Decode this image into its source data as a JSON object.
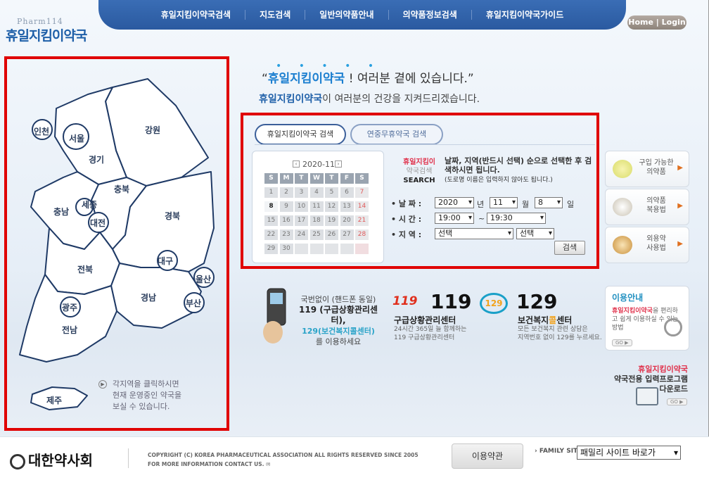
{
  "header": {
    "logo_sub": "Pharm114",
    "logo_main": "휴일지킴이약국",
    "nav": [
      "휴일지킴이약국검색",
      "지도검색",
      "일반의약품안내",
      "의약품정보검색",
      "휴일지킴이약국가이드"
    ],
    "home_login": "Home | Login"
  },
  "map": {
    "regions": [
      "인천",
      "서울",
      "경기",
      "강원",
      "충북",
      "충남",
      "세종",
      "대전",
      "경북",
      "대구",
      "전북",
      "울산",
      "경남",
      "광주",
      "부산",
      "전남",
      "제주"
    ],
    "note_lines": [
      "각지역을 클릭하시면",
      "현재 운영중인 약국을",
      "보실 수 있습니다."
    ]
  },
  "slogan": {
    "line1_brand": "휴일지킴이약국",
    "line1_rest": " ! 여러분 곁에 있습니다.",
    "line1_open": "“",
    "line1_close": "”",
    "line2_brand": "휴일지킴이약국",
    "line2_rest": "이 여러분의 건강을 지켜드리겠습니다."
  },
  "search": {
    "tab_active": "휴일지킴이약국 검색",
    "tab_inactive": "연중무휴약국 검색",
    "calendar": {
      "title": "2020-11",
      "prev": "‹",
      "next": "›",
      "weekday_heads": [
        "S",
        "M",
        "T",
        "W",
        "T",
        "F",
        "S"
      ],
      "weeks": [
        [
          "1",
          "2",
          "3",
          "4",
          "5",
          "6",
          "7"
        ],
        [
          "8",
          "9",
          "10",
          "11",
          "12",
          "13",
          "14"
        ],
        [
          "15",
          "16",
          "17",
          "18",
          "19",
          "20",
          "21"
        ],
        [
          "22",
          "23",
          "24",
          "25",
          "26",
          "27",
          "28"
        ],
        [
          "29",
          "30",
          "",
          "",
          "",
          "",
          ""
        ]
      ],
      "today": "8"
    },
    "label_line1": "휴일지킴이",
    "label_line2": "약국검색",
    "label_line3": "SEARCH",
    "instructions": "날짜, 지역(반드시 선택) 순으로 선택한 후 검색하시면 됩니다.",
    "instructions_note": "(도로명 이름은 입력하지 않아도 됩니다.)",
    "date_label": "• 날 짜 :",
    "time_label": "• 시 간 :",
    "region_label": "• 지 역 :",
    "year": "2020",
    "year_unit": "년",
    "month": "11",
    "month_unit": "월",
    "day": "8",
    "day_unit": "일",
    "time_from": "19:00",
    "time_sep": "~",
    "time_to": "19:30",
    "region1": "선택",
    "region2": "선택",
    "search_button": "검색"
  },
  "side_buttons": [
    {
      "line1": "구입 가능한",
      "line2": "의약품",
      "arrow": "▶"
    },
    {
      "line1": "의약품",
      "line2": "복용법",
      "arrow": "▶"
    },
    {
      "line1": "외용약",
      "line2": "사용법",
      "arrow": "▶"
    }
  ],
  "phone_info": {
    "line1": "국번없이 (핸드폰 동일)",
    "line2": "119 (구급상황관리센터),",
    "line3": "129(보건복지콜센터)",
    "line4": "를 이용하세요"
  },
  "call119": {
    "logo": "119",
    "number": "119",
    "title": "구급상황관리센터",
    "desc1": "24시간 365일 늘 함께하는",
    "desc2": "119 구급상황관리센터"
  },
  "call129": {
    "logo": "129",
    "number": "129",
    "title_a": "보건복지",
    "title_b": "콜",
    "title_c": "센터",
    "desc1": "모든 보건복지 관련 상담은",
    "desc2": "지역번호 없이 129를 누르세요."
  },
  "guide": {
    "title": "이용안내",
    "desc_brand": "휴일지킴이약국",
    "desc_rest": "을 편리하고 쉽게 이용하실 수 있는 방법",
    "go": "GO ▶"
  },
  "download": {
    "line1": "휴일지킴이약국",
    "line2": "약국전용 입력프로그램",
    "line3": "다운로드",
    "go": "GO ▶"
  },
  "footer": {
    "org": "대한약사회",
    "copyright": "COPYRIGHT (C) KOREA PHARMACEUTICAL ASSOCIATION ALL RIGHTS RESERVED SINCE 2005",
    "contact": "FOR MORE INFORMATION CONTACT US. ✉",
    "terms": "이용약관",
    "family_label": "› FAMILY SITE",
    "family_select": "패밀리 사이트 바로가"
  },
  "colors": {
    "accent_red": "#e00000",
    "brand_blue": "#1e5fa8",
    "nav_blue": "#2a5aa0"
  }
}
